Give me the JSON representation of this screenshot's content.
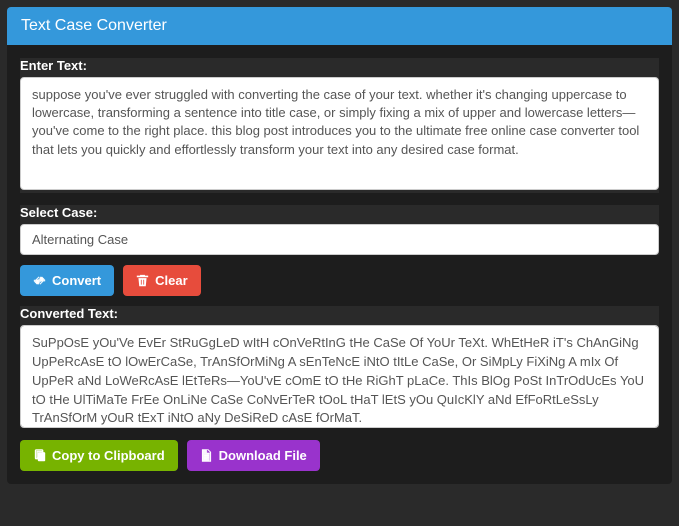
{
  "header": {
    "title": "Text Case Converter"
  },
  "input": {
    "label": "Enter Text:",
    "value": "suppose you've ever struggled with converting the case of your text. whether it's changing uppercase to lowercase, transforming a sentence into title case, or simply fixing a mix of upper and lowercase letters—you've come to the right place. this blog post introduces you to the ultimate free online case converter tool that lets you quickly and effortlessly transform your text into any desired case format."
  },
  "select": {
    "label": "Select Case:",
    "value": "Alternating Case"
  },
  "actions": {
    "convert": "Convert",
    "clear": "Clear"
  },
  "output": {
    "label": "Converted Text:",
    "value": "SuPpOsE yOu'Ve EvEr StRuGgLeD wItH cOnVeRtInG tHe CaSe Of YoUr TeXt. WhEtHeR iT's ChAnGiNg UpPeRcAsE tO lOwErCaSe, TrAnSfOrMiNg A sEnTeNcE iNtO tItLe CaSe, Or SiMpLy FiXiNg A mIx Of UpPeR aNd LoWeRcAsE lEtTeRs—YoU'vE cOmE tO tHe RiGhT pLaCe. ThIs BlOg PoSt InTrOdUcEs YoU tO tHe UlTiMaTe FrEe OnLiNe CaSe CoNvErTeR tOoL tHaT lEtS yOu QuIcKlY aNd EfFoRtLeSsLy TrAnSfOrM yOuR tExT iNtO aNy DeSiReD cAsE fOrMaT."
  },
  "footer": {
    "copy": "Copy to Clipboard",
    "download": "Download File"
  }
}
